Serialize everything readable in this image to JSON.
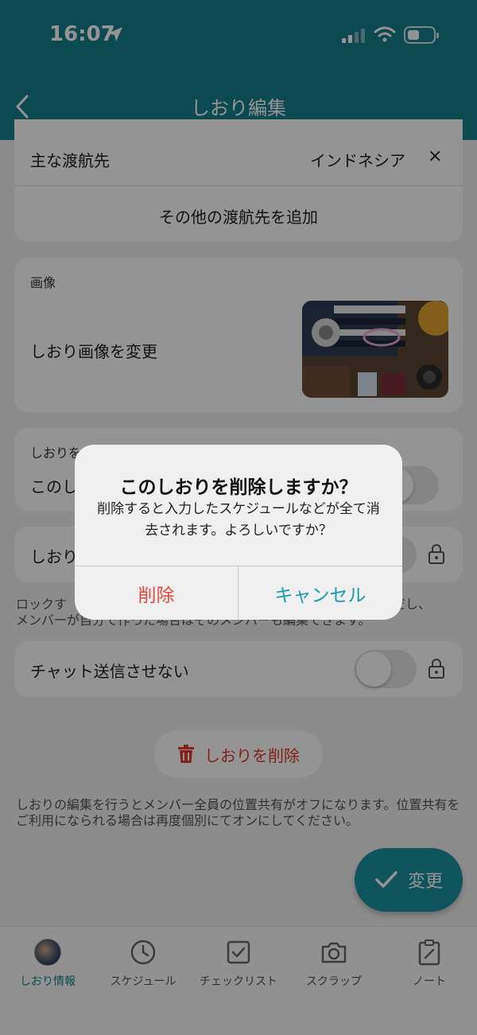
{
  "status_bar": {
    "time": "16:07"
  },
  "header": {
    "title": "しおり編集"
  },
  "destination": {
    "label": "主な渡航先",
    "value": "インドネシア",
    "remove_symbol": "×",
    "add_other": "その他の渡航先を追加"
  },
  "image_section": {
    "label": "画像",
    "change_label": "しおり画像を変更"
  },
  "partial_rows": {
    "section_label_partial": "しおりを",
    "row1_partial": "このし",
    "row2_partial": "しおり"
  },
  "lock_note": {
    "line1_left": "ロックす",
    "line1_right": "だし、",
    "line2": "メンバーが自分で作った場合はそのメンバーも編集できます。"
  },
  "chat_row": {
    "label": "チャット送信させない",
    "toggle_on": false
  },
  "delete_button": {
    "label": "しおりを削除"
  },
  "footer_note": "しおりの編集を行うとメンバー全員の位置共有がオフになります。位置共有をご利用になられる場合は再度個別にてオンにしてください。",
  "fab": {
    "label": "変更"
  },
  "tabs": [
    {
      "label": "しおり情報",
      "icon": "avatar",
      "active": true
    },
    {
      "label": "スケジュール",
      "icon": "clock-icon",
      "active": false
    },
    {
      "label": "チェックリスト",
      "icon": "checkbox-icon",
      "active": false
    },
    {
      "label": "スクラップ",
      "icon": "camera-icon",
      "active": false
    },
    {
      "label": "ノート",
      "icon": "note-icon",
      "active": false
    }
  ],
  "dialog": {
    "title": "このしおりを削除しますか？",
    "message": "削除すると入力したスケジュールなどが全て消去されます。よろしいですか？",
    "delete_label": "削除",
    "cancel_label": "キャンセル"
  },
  "colors": {
    "header": "#157f8c",
    "accent": "#1a9ab0",
    "danger": "#e8493d"
  }
}
